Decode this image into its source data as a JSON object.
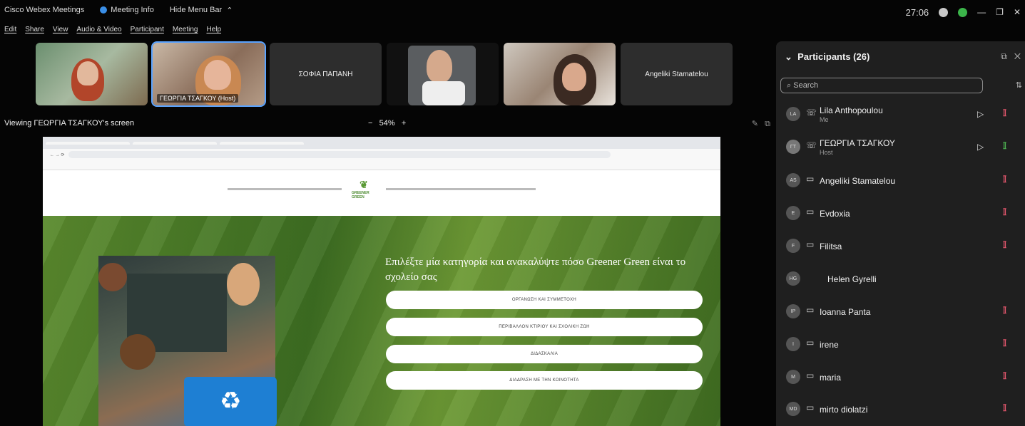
{
  "titlebar": {
    "app_name": "Cisco Webex Meetings",
    "meeting_info": "Meeting Info",
    "hide_menu": "Hide Menu Bar",
    "clock": "27:06"
  },
  "menu": [
    "Edit",
    "Share",
    "View",
    "Audio & Video",
    "Participant",
    "Meeting",
    "Help"
  ],
  "video_tiles": [
    {
      "label": ""
    },
    {
      "label": "ΓΕΩΡΓΙΑ ΤΣΑΓΚΟΥ (Host)"
    },
    {
      "label": "ΣΟΦΙΑ ΠΑΠΑΝΗ"
    },
    {
      "label": ""
    },
    {
      "label": ""
    },
    {
      "label": "Angeliki Stamatelou"
    }
  ],
  "viewing": {
    "text": "Viewing ΓΕΩΡΓΙΑ ΤΣΑΓΚΟΥ's screen",
    "zoom_minus": "−",
    "zoom_value": "54%",
    "zoom_plus": "+"
  },
  "shared_screen": {
    "hero_title": "Επιλέξτε μία κατηγορία και ανακαλύψτε πόσο Greener Green είναι το σχολείο σας",
    "logo_text": "GREENER GREEN",
    "buttons": [
      "ΟΡΓΑΝΩΣΗ ΚΑΙ ΣΥΜΜΕΤΟΧΗ",
      "ΠΕΡΙΒΑΛΛΟΝ ΚΤΙΡΙΟΥ ΚΑΙ ΣΧΟΛΙΚΗ ΖΩΗ",
      "ΔΙΔΑΣΚΑΛΙΑ",
      "ΔΙΑΔΡΑΣΗ ΜΕ ΤΗΝ ΚΟΙΝΟΤΗΤΑ"
    ]
  },
  "participants": {
    "title": "Participants (26)",
    "search_placeholder": "Search",
    "list": [
      {
        "initials": "LA",
        "name": "Lila Anthopoulou",
        "role": "Me",
        "type": "call",
        "video": true,
        "mic": "muted"
      },
      {
        "initials": "ΓΤ",
        "name": "ΓΕΩΡΓΙΑ ΤΣΑΓΚΟΥ",
        "role": "Host",
        "type": "call",
        "video": true,
        "mic": "on"
      },
      {
        "initials": "AS",
        "name": "Angeliki Stamatelou",
        "role": "",
        "type": "device",
        "video": false,
        "mic": "muted"
      },
      {
        "initials": "E",
        "name": "Evdoxia",
        "role": "",
        "type": "device",
        "video": false,
        "mic": "muted"
      },
      {
        "initials": "F",
        "name": "Filitsa",
        "role": "",
        "type": "device",
        "video": false,
        "mic": "muted"
      },
      {
        "initials": "HG",
        "name": "Helen Gyrelli",
        "role": "",
        "type": "none",
        "video": false,
        "mic": "none"
      },
      {
        "initials": "IP",
        "name": "Ioanna Panta",
        "role": "",
        "type": "device",
        "video": false,
        "mic": "muted"
      },
      {
        "initials": "I",
        "name": "irene",
        "role": "",
        "type": "device",
        "video": false,
        "mic": "muted"
      },
      {
        "initials": "M",
        "name": "maria",
        "role": "",
        "type": "device",
        "video": false,
        "mic": "muted"
      },
      {
        "initials": "MD",
        "name": "mirto diolatzi",
        "role": "",
        "type": "device",
        "video": false,
        "mic": "muted"
      }
    ]
  }
}
